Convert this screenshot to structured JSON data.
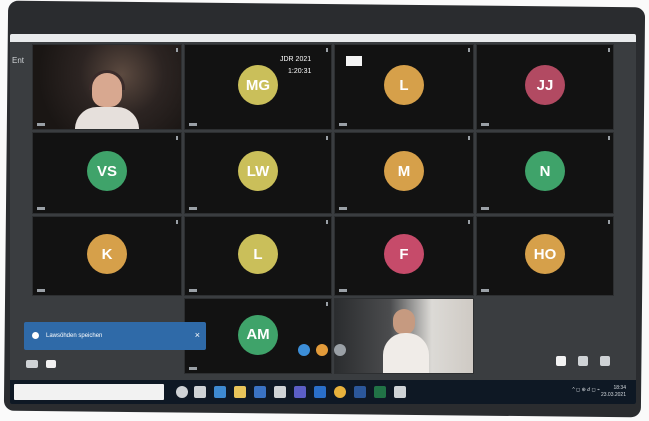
{
  "window": {
    "left_header": "Ent",
    "recording_label": "JDR 2021",
    "recording_time": "1:20:31"
  },
  "tiles": [
    {
      "kind": "video",
      "label": "",
      "name": "participant-1"
    },
    {
      "kind": "avatar",
      "initials": "MG",
      "color": "#cabf5a"
    },
    {
      "kind": "avatar",
      "initials": "L",
      "color": "#d6a04a"
    },
    {
      "kind": "avatar",
      "initials": "JJ",
      "color": "#b24a62"
    },
    {
      "kind": "avatar",
      "initials": "VS",
      "color": "#3fa36a"
    },
    {
      "kind": "avatar",
      "initials": "LW",
      "color": "#cabf5a"
    },
    {
      "kind": "avatar",
      "initials": "M",
      "color": "#d6a04a"
    },
    {
      "kind": "avatar",
      "initials": "N",
      "color": "#3fa36a"
    },
    {
      "kind": "avatar",
      "initials": "K",
      "color": "#d6a04a"
    },
    {
      "kind": "avatar",
      "initials": "L",
      "color": "#cabf5a"
    },
    {
      "kind": "avatar",
      "initials": "F",
      "color": "#c64b6a"
    },
    {
      "kind": "avatar",
      "initials": "HO",
      "color": "#d6a04a"
    },
    {
      "kind": "avatar",
      "initials": "AM",
      "color": "#3fa36a"
    },
    {
      "kind": "video",
      "label": "",
      "name": "participant-2"
    }
  ],
  "notification": {
    "text": "Lawsöhden speichen",
    "close": "×"
  },
  "taskbar": {
    "tray_text": "^ ◻ ⊕ 𝑑 ◻ ⌁",
    "clock_time": "18:34",
    "clock_date": "23.03.2021"
  }
}
